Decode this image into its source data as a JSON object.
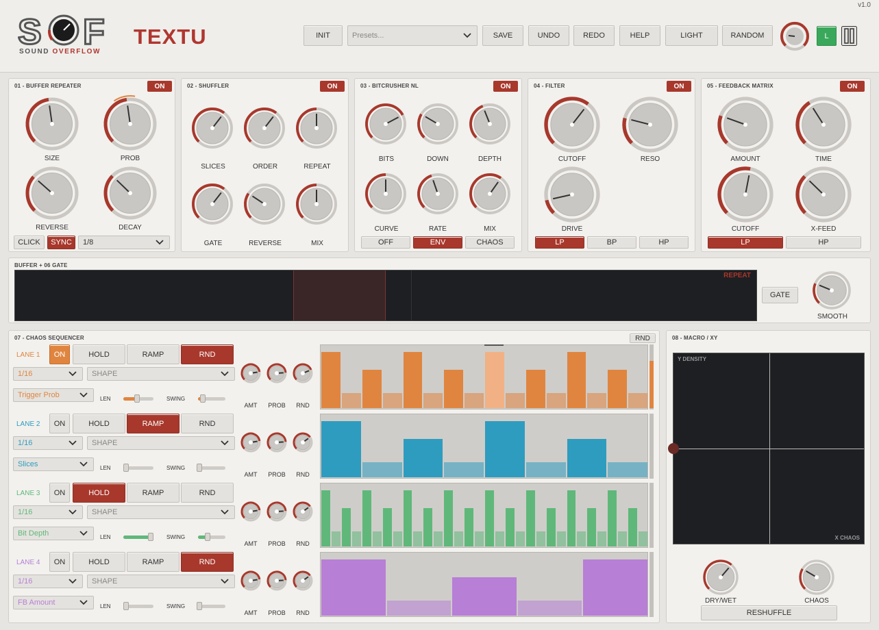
{
  "header": {
    "version": "v1.0",
    "brand": {
      "word1": "SOUND",
      "word2": "OVERFLOW"
    },
    "app_name": "TEXTU",
    "buttons": {
      "init": "INIT",
      "save": "SAVE",
      "undo": "UNDO",
      "redo": "REDO",
      "help": "HELP",
      "light": "LIGHT",
      "random": "RANDOM",
      "link": "L"
    },
    "presets_placeholder": "Presets..."
  },
  "modules": {
    "m1": {
      "title": "01 - BUFFER REPEATER",
      "on": "ON",
      "knobs": [
        "SIZE",
        "PROB",
        "REVERSE",
        "DECAY"
      ],
      "click": "CLICK",
      "sync": "SYNC",
      "division": "1/8"
    },
    "m2": {
      "title": "02 - SHUFFLER",
      "on": "ON",
      "knobs": [
        "SLICES",
        "ORDER",
        "REPEAT",
        "GATE",
        "REVERSE",
        "MIX"
      ]
    },
    "m3": {
      "title": "03 - BITCRUSHER NL",
      "on": "ON",
      "knobs": [
        "BITS",
        "DOWN",
        "DEPTH",
        "CURVE",
        "RATE",
        "MIX"
      ],
      "modes": [
        "OFF",
        "ENV",
        "CHAOS"
      ]
    },
    "m4": {
      "title": "04 - FILTER",
      "on": "ON",
      "knobs": [
        "CUTOFF",
        "RESO",
        "DRIVE"
      ],
      "modes": [
        "LP",
        "BP",
        "HP"
      ]
    },
    "m5": {
      "title": "05 - FEEDBACK MATRIX",
      "on": "ON",
      "knobs": [
        "AMOUNT",
        "TIME",
        "CUTOFF",
        "X-FEED"
      ],
      "modes": [
        "LP",
        "HP"
      ]
    }
  },
  "buffer": {
    "title": "BUFFER + 06 GATE",
    "repeat_label": "REPEAT",
    "gate": "GATE",
    "smooth": "SMOOTH"
  },
  "sequencer": {
    "title": "07 - CHAOS SEQUENCER",
    "rnd": "RND",
    "mode_labels": {
      "on": "ON",
      "hold": "HOLD",
      "ramp": "RAMP",
      "rnd": "RND"
    },
    "shape_placeholder": "SHAPE",
    "len_label": "LEN",
    "swing_label": "SWING",
    "knob_labels": [
      "AMT",
      "PROB",
      "RND"
    ],
    "lanes": [
      {
        "name": "LANE 1",
        "color": "#e0853f",
        "division": "1/16",
        "target": "Trigger Prob",
        "mode": "RND",
        "on": true
      },
      {
        "name": "LANE 2",
        "color": "#2e9cbf",
        "division": "1/16",
        "target": "Slices",
        "mode": "RAMP",
        "on": false
      },
      {
        "name": "LANE 3",
        "color": "#5fb87a",
        "division": "1/16",
        "target": "Bit Depth",
        "mode": "HOLD",
        "on": false
      },
      {
        "name": "LANE 4",
        "color": "#b77fd6",
        "division": "1/16",
        "target": "FB Amount",
        "mode": "RND",
        "on": false
      }
    ]
  },
  "macro": {
    "title": "08 - MACRO / XY",
    "y_label": "Y DENSITY",
    "x_label": "X CHAOS",
    "drywet": "DRY/WET",
    "chaos": "CHAOS",
    "reshuffle": "RESHUFFLE"
  }
}
